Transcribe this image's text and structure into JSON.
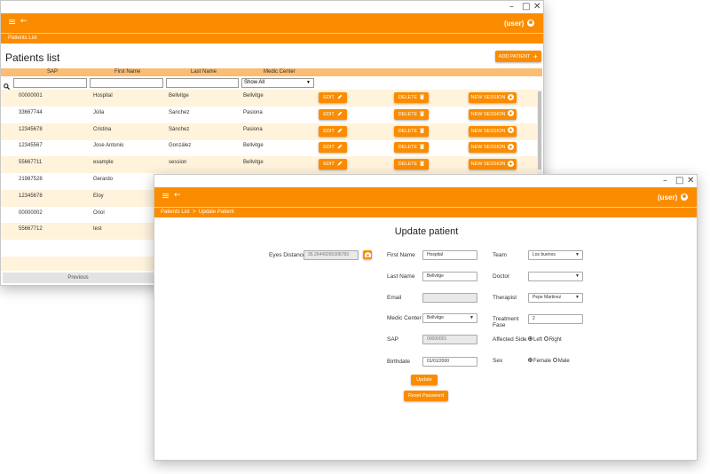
{
  "back_window": {
    "controls": {
      "minimize": "–",
      "maximize": "□",
      "close": "✕"
    },
    "appbar": {
      "menu_icon": "≡",
      "back_icon": "←",
      "user": "(user)"
    },
    "breadcrumb": "Patients List",
    "page_title": "Patients list",
    "add_patient_label": "ADD PATIENT",
    "add_patient_icon": "+",
    "columns": [
      "SAP",
      "First Name",
      "Last Name",
      "Medic Center"
    ],
    "filter": {
      "search_icon": "🔍",
      "medic_center_selected": "Show All"
    },
    "row_actions": {
      "edit": "EDIT",
      "delete": "DELETE",
      "new_session": "NEW SESSION"
    },
    "rows": [
      {
        "sap": "00000001",
        "first": "Hospital",
        "last": "Bellvitge",
        "center": "Bellvitge"
      },
      {
        "sap": "33667744",
        "first": "Júlia",
        "last": "Sanchez",
        "center": "Pasiona"
      },
      {
        "sap": "12345678",
        "first": "Cristina",
        "last": "Sànchez",
        "center": "Pasiona"
      },
      {
        "sap": "12345567",
        "first": "Jose Antonio",
        "last": "González",
        "center": "Bellvitge"
      },
      {
        "sap": "55667711",
        "first": "example",
        "last": "session",
        "center": "Bellvitge"
      },
      {
        "sap": "21987528",
        "first": "Gerardo",
        "last": "",
        "center": ""
      },
      {
        "sap": "12345678",
        "first": "Eloy",
        "last": "",
        "center": ""
      },
      {
        "sap": "00000002",
        "first": "Oriol",
        "last": "",
        "center": ""
      },
      {
        "sap": "55667712",
        "first": "test",
        "last": "",
        "center": ""
      }
    ],
    "pagination": {
      "previous": "Previous"
    }
  },
  "front_window": {
    "controls": {
      "minimize": "–",
      "maximize": "□",
      "close": "✕"
    },
    "appbar": {
      "menu_icon": "≡",
      "back_icon": "←",
      "user": "(user)"
    },
    "breadcrumb": "Patients List  >  Update Patient",
    "title": "Update patient",
    "eyes_distance": {
      "label": "Eyes Distance",
      "value": "35.26449265306783"
    },
    "first_name": {
      "label": "First Name",
      "value": "Hospital"
    },
    "last_name": {
      "label": "Last Name",
      "value": "Bellvitge"
    },
    "email": {
      "label": "Email",
      "value": ""
    },
    "medic_center": {
      "label": "Medic Center",
      "value": "Bellvitge"
    },
    "sap": {
      "label": "SAP",
      "value": "00000001"
    },
    "birthdate": {
      "label": "Birthdate",
      "value": "01/01/2000"
    },
    "team": {
      "label": "Team",
      "value": "Los buenos"
    },
    "doctor": {
      "label": "Doctor",
      "value": ""
    },
    "therapist": {
      "label": "Therapist",
      "value": "Pepe Martinez"
    },
    "treatment_fase": {
      "label_line1": "Treatment",
      "label_line2": "Fase",
      "value": "2"
    },
    "affected_side": {
      "label": "Affected Side",
      "left": "Left",
      "right": "Right"
    },
    "sex": {
      "label": "Sex",
      "female": "Female",
      "male": "Male"
    },
    "update_label": "Update",
    "reset_password_label": "Reset Password"
  }
}
